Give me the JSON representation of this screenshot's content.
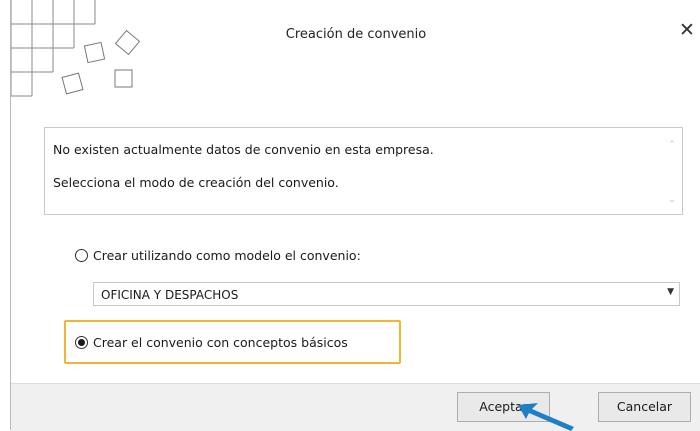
{
  "dialog": {
    "title": "Creación de convenio",
    "close_glyph": "✕",
    "logo_icon": "grid-squares-logo-icon"
  },
  "message": {
    "line1": "No existen actualmente datos de convenio en esta empresa.",
    "line2": "Selecciona el modo de creación del convenio.",
    "scroll_up_glyph": "⌃",
    "scroll_down_glyph": "⌄"
  },
  "options": {
    "template_label": "Crear utilizando como modelo el convenio:",
    "template_selected": false,
    "template_value": "OFICINA Y DESPACHOS",
    "basic_label": "Crear el convenio con conceptos básicos",
    "basic_selected": true
  },
  "buttons": {
    "accept": "Aceptar",
    "cancel": "Cancelar"
  },
  "colors": {
    "highlight": "#f2b533",
    "pointer": "#1f7fc4"
  }
}
